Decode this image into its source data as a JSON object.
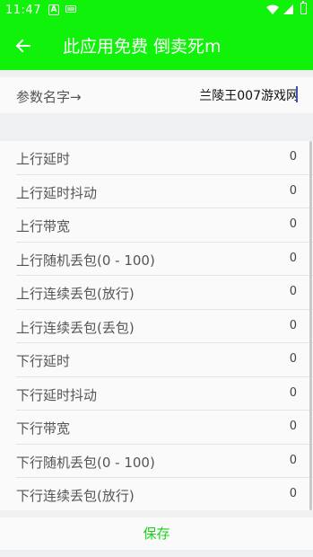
{
  "status_bar": {
    "time": "11:47",
    "icons": [
      "notification-a-icon",
      "notification-b-icon",
      "wifi-icon",
      "cell-signal-icon",
      "battery-icon"
    ]
  },
  "app_bar": {
    "title": "此应用免费   倒卖死m",
    "background": "#11f20a"
  },
  "param": {
    "label": "参数名字→",
    "value": "兰陵王007游戏网"
  },
  "settings": [
    {
      "label": "上行延时",
      "value": "0"
    },
    {
      "label": "上行延时抖动",
      "value": "0"
    },
    {
      "label": "上行带宽",
      "value": "0"
    },
    {
      "label": "上行随机丢包(0 - 100)",
      "value": "0"
    },
    {
      "label": "上行连续丢包(放行)",
      "value": "0"
    },
    {
      "label": "上行连续丢包(丢包)",
      "value": "0"
    },
    {
      "label": "下行延时",
      "value": "0"
    },
    {
      "label": "下行延时抖动",
      "value": "0"
    },
    {
      "label": "下行带宽",
      "value": "0"
    },
    {
      "label": "下行随机丢包(0 - 100)",
      "value": "0"
    },
    {
      "label": "下行连续丢包(放行)",
      "value": "0"
    }
  ],
  "save_label": "保存",
  "save_color": "#19d216"
}
